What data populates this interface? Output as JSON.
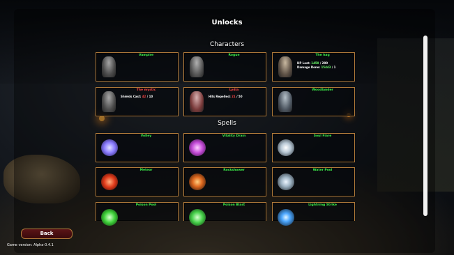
{
  "title": "Unlocks",
  "sections": {
    "characters": "Characters",
    "spells": "Spells"
  },
  "characters": [
    {
      "name": "Vampire",
      "color": "green",
      "stats": []
    },
    {
      "name": "Rogue",
      "color": "green",
      "stats": []
    },
    {
      "name": "The hag",
      "color": "green",
      "stats": [
        {
          "label": "HP Lost:",
          "value": "1450",
          "total": " / 200"
        },
        {
          "label": "Damage Done:",
          "value": "15443",
          "total": " / 1"
        }
      ]
    },
    {
      "name": "The mystic",
      "color": "red",
      "stats": [
        {
          "label": "Shields Cast:",
          "value": "42",
          "total": " / 10"
        }
      ]
    },
    {
      "name": "Lydia",
      "color": "red",
      "stats": [
        {
          "label": "Hits Repelled:",
          "value": "21",
          "total": " / 50"
        }
      ]
    },
    {
      "name": "Woodlander",
      "color": "green",
      "stats": []
    }
  ],
  "spells": [
    {
      "name": "Volley",
      "orb_color": "#8a7bff"
    },
    {
      "name": "Vitality Drain",
      "orb_color": "#c44bd8"
    },
    {
      "name": "Soul Fiare",
      "orb_color": "#b9c9d6"
    },
    {
      "name": "Meteor",
      "orb_color": "#e03a1a"
    },
    {
      "name": "Rockshower",
      "orb_color": "#e06a20"
    },
    {
      "name": "Water Pool",
      "orb_color": "#9fb4c4"
    },
    {
      "name": "Poison Pool",
      "orb_color": "#3fd23a"
    },
    {
      "name": "Poison Blast",
      "orb_color": "#46d04a"
    },
    {
      "name": "Lightning Strike",
      "orb_color": "#4da8ff"
    }
  ],
  "buttons": {
    "back": "Back"
  },
  "version": "Game version: Alpha-0.4.1"
}
